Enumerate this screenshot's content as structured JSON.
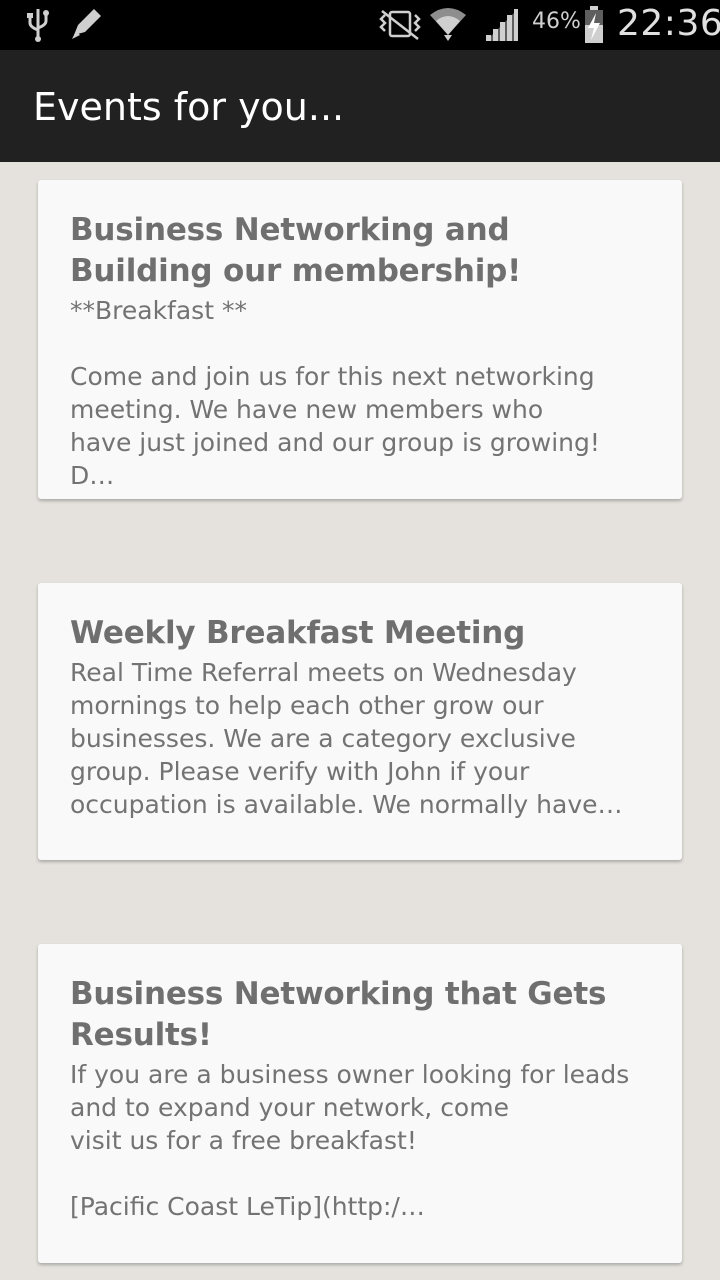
{
  "status_bar": {
    "battery_percent": "46%",
    "time": "22:36",
    "icons": [
      "usb-icon",
      "pencil-icon",
      "vibrate-icon",
      "wifi-icon",
      "signal-icon",
      "battery-charging-icon"
    ]
  },
  "action_bar": {
    "title": "Events for you..."
  },
  "events": [
    {
      "title": "Business Networking and Building our membership!",
      "description": "**Breakfast **\n\nCome and join us for this next networking meeting. We have new members who\nhave just joined and our group is growing! D…"
    },
    {
      "title": "Weekly Breakfast Meeting",
      "description": "Real Time Referral meets on Wednesday mornings to help each other grow our businesses. We are a category exclusive group. Please verify with John if your occupation is available. We normally have…"
    },
    {
      "title": "Business Networking that Gets Results!",
      "description": "If you are a business owner looking for leads and to expand your network, come\nvisit us for a free breakfast!\n\n[Pacific Coast LeTip](http:/…"
    }
  ]
}
